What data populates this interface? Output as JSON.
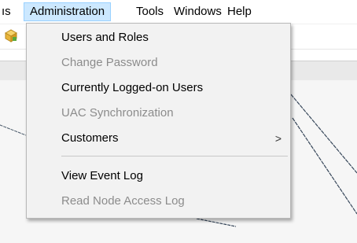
{
  "menubar": {
    "items": [
      {
        "label": "ıs"
      },
      {
        "label": "Administration"
      },
      {
        "label": "Tools"
      },
      {
        "label": "Windows"
      },
      {
        "label": "Help"
      }
    ]
  },
  "toolbar": {
    "icons": [
      "package-icon"
    ]
  },
  "administration_menu": {
    "items": [
      {
        "label": "Users and Roles",
        "enabled": true
      },
      {
        "label": "Change Password",
        "enabled": false
      },
      {
        "label": "Currently Logged-on Users",
        "enabled": true
      },
      {
        "label": "UAC Synchronization",
        "enabled": false
      },
      {
        "label": "Customers",
        "enabled": true,
        "submenu_arrow": ">"
      },
      {
        "label": "View Event Log",
        "enabled": true
      },
      {
        "label": "Read Node Access Log",
        "enabled": false
      }
    ]
  },
  "colors": {
    "menu_background": "#f2f2f2",
    "active_menu_highlight": "#cce8ff",
    "active_menu_border": "#99d1ff",
    "disabled_text": "#8c8c8c"
  }
}
